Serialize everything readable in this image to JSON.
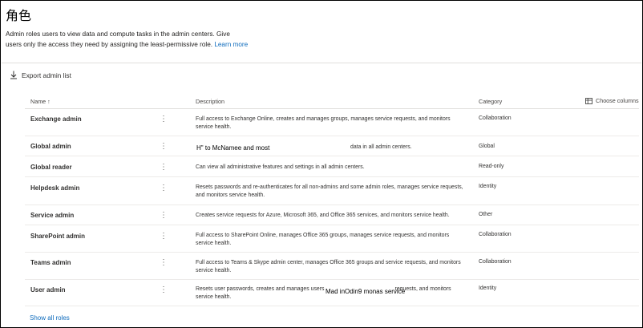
{
  "page": {
    "title": "角色",
    "intro_line1": "Admin roles users to view data and compute tasks in the admin centers. Give",
    "intro_line2": "users only the access they need by assigning the least-permissive role.",
    "learn_more": "Learn more"
  },
  "toolbar": {
    "export_label": "Export admin list"
  },
  "table": {
    "columns": {
      "name": "Name ↑",
      "description": "Description",
      "category": "Category"
    },
    "choose_columns": "Choose columns",
    "more_glyph": "⋮",
    "rows": [
      {
        "name": "Exchange admin",
        "description": "Full access to Exchange Online, creates and manages groups, manages service requests, and monitors service health.",
        "category": "Collaboration"
      },
      {
        "name": "Global admin",
        "description": "data in all admin centers.",
        "category": "Global"
      },
      {
        "name": "Global reader",
        "description": "Can view all administrative features and settings in all admin centers.",
        "category": "Read-only"
      },
      {
        "name": "Helpdesk admin",
        "description": "Resets passwords and re-authenticates for all non-admins and some admin roles, manages service requests, and monitors service health.",
        "category": "Identity"
      },
      {
        "name": "Service admin",
        "description": "Creates service requests for Azure, Microsoft 365, and Office 365 services, and monitors service health.",
        "category": "Other"
      },
      {
        "name": "SharePoint admin",
        "description": "Full access to SharePoint Online, manages Office 365 groups, manages service requests, and monitors service health.",
        "category": "Collaboration"
      },
      {
        "name": "Teams admin",
        "description": "Full access to Teams & Skype admin center, manages Office 365 groups and service requests, and monitors service health.",
        "category": "Collaboration"
      },
      {
        "name": "User admin",
        "description": "Resets user passwords, creates and manages users                                              requests, and monitors service health.",
        "category": "Identity"
      }
    ]
  },
  "overlays": {
    "global_admin_text": "H\" to McNamee and most",
    "user_admin_text": "Mad inOdin9 monas service"
  },
  "footer": {
    "show_all": "Show all roles"
  }
}
